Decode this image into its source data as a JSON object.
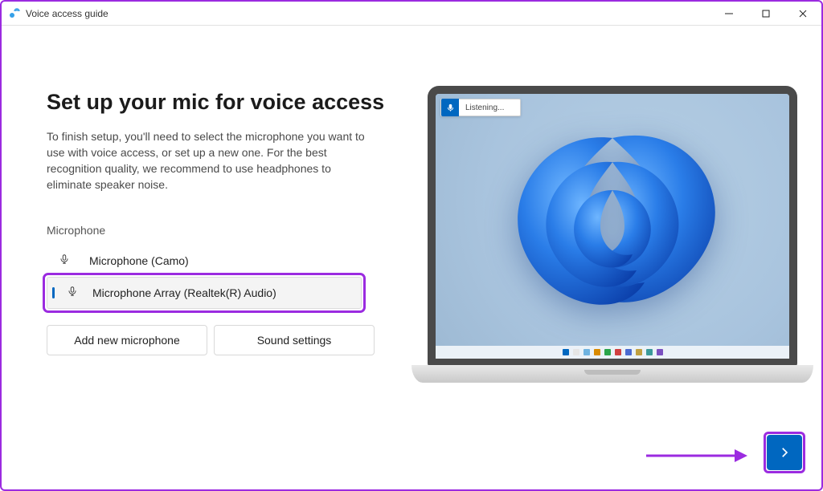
{
  "window": {
    "title": "Voice access guide"
  },
  "main": {
    "heading": "Set up your mic for voice access",
    "description": "To finish setup, you'll need to select the microphone you want to use with voice access, or set up a new one. For the best recognition quality, we recommend to use headphones to eliminate speaker noise.",
    "mic_section_label": "Microphone",
    "mics": [
      {
        "label": "Microphone (Camo)",
        "selected": false
      },
      {
        "label": "Microphone Array (Realtek(R) Audio)",
        "selected": true
      }
    ],
    "add_mic_label": "Add new microphone",
    "sound_settings_label": "Sound settings"
  },
  "preview": {
    "listening_label": "Listening...",
    "taskbar_icon_colors": [
      "#0067c0",
      "#e5e5e5",
      "#6fb3e0",
      "#d98a00",
      "#2aa54a",
      "#d04040",
      "#4a6ad0",
      "#c0a040",
      "#3a9a9a",
      "#7a50c0"
    ]
  },
  "colors": {
    "accent": "#0067c0",
    "annotation": "#9b2be0"
  }
}
